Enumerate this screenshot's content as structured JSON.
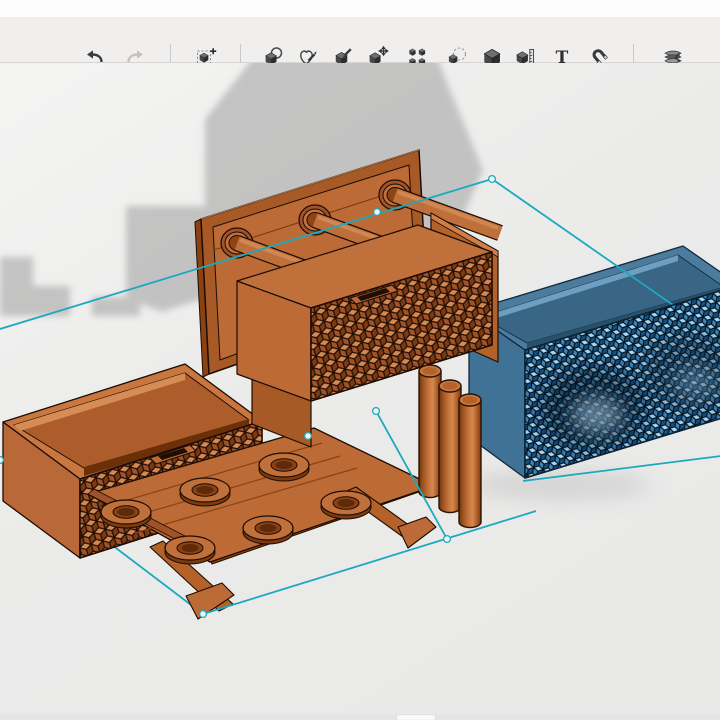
{
  "toolbar": {
    "buttons": [
      {
        "id": "undo",
        "icon": "undo-icon",
        "enabled": true,
        "has_dropdown": false
      },
      {
        "id": "redo",
        "icon": "redo-icon",
        "enabled": false,
        "has_dropdown": false
      },
      {
        "id": "add-shape",
        "icon": "add-shape-icon",
        "enabled": true,
        "has_dropdown": true
      },
      {
        "id": "group",
        "icon": "group-shapes-icon",
        "enabled": true,
        "has_dropdown": true
      },
      {
        "id": "sketch",
        "icon": "sketch-pencil-icon",
        "enabled": true,
        "has_dropdown": true
      },
      {
        "id": "deform",
        "icon": "brush-cube-icon",
        "enabled": true,
        "has_dropdown": true
      },
      {
        "id": "transform",
        "icon": "move-cube-icon",
        "enabled": true,
        "has_dropdown": true
      },
      {
        "id": "array",
        "icon": "array-cubes-icon",
        "enabled": true,
        "has_dropdown": true
      },
      {
        "id": "duplicate",
        "icon": "copy-cube-icon",
        "enabled": true,
        "has_dropdown": true
      },
      {
        "id": "solid",
        "icon": "solid-cube-icon",
        "enabled": true,
        "has_dropdown": true
      },
      {
        "id": "measure",
        "icon": "measure-cube-icon",
        "enabled": true,
        "has_dropdown": true
      },
      {
        "id": "text",
        "icon": "text-tool-icon",
        "enabled": true,
        "has_dropdown": false
      },
      {
        "id": "snap",
        "icon": "magnet-icon",
        "enabled": true,
        "has_dropdown": true
      },
      {
        "id": "slice",
        "icon": "layers-slice-icon",
        "enabled": true,
        "has_dropdown": true
      }
    ]
  },
  "canvas": {
    "background": "#ececec",
    "shadow_color": "#bdbdbd",
    "selection_color": "#1ca9bf",
    "selection_handle_count": 7,
    "objects": [
      {
        "name": "hinged-lid-panel",
        "color": "#bc6b36",
        "detail": "back plaque with 3 pin bosses"
      },
      {
        "name": "pattern-drawer-top",
        "color": "#c0703b",
        "pattern": "cube-lattice"
      },
      {
        "name": "front-plate",
        "color": "#b4622a"
      },
      {
        "name": "open-box-bottom-left",
        "color": "#c0703b",
        "pattern": "cube-lattice"
      },
      {
        "name": "base-plate-with-bosses",
        "color": "#bc6b36",
        "boss_count": 6
      },
      {
        "name": "pins",
        "color": "#c0703b",
        "count": 3
      },
      {
        "name": "voronoi-box",
        "color": "#3f7295",
        "pattern": "diamond-lattice"
      }
    ]
  }
}
